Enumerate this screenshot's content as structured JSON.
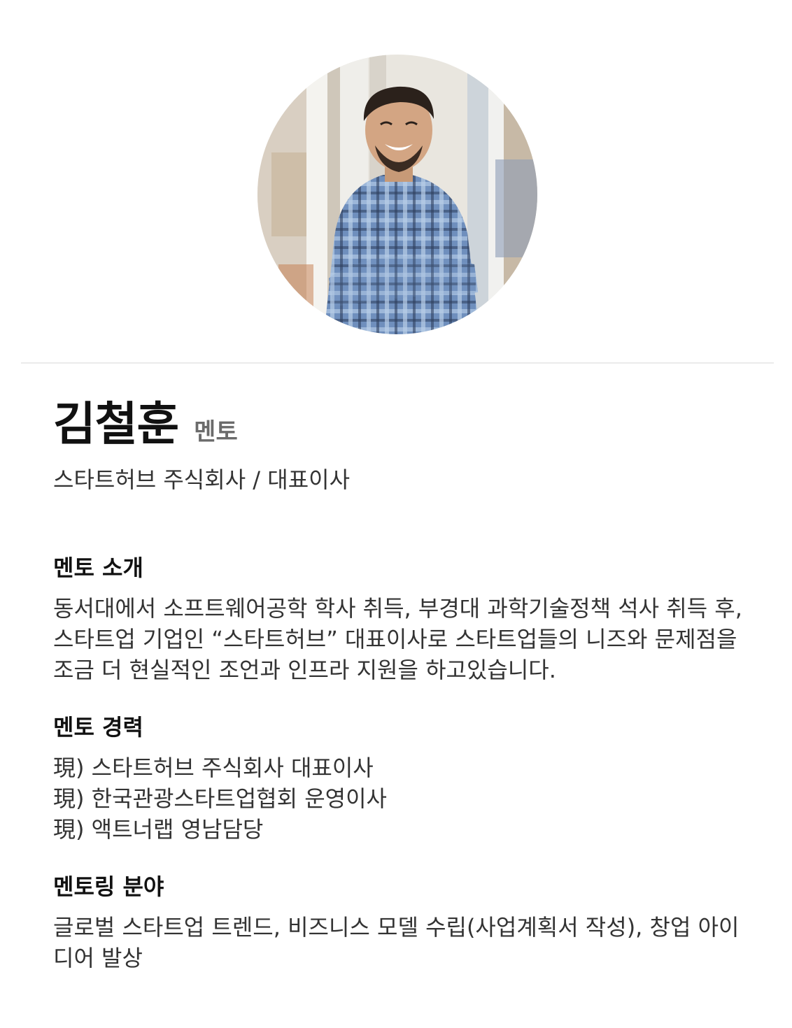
{
  "profile": {
    "name": "김철훈",
    "role": "멘토",
    "affiliation": "스타트허브 주식회사 / 대표이사",
    "photo_icon": "person-photo-icon"
  },
  "sections": {
    "intro": {
      "title": "멘토 소개",
      "body": "동서대에서 소프트웨어공학 학사 취득, 부경대 과학기술정책 석사 취득 후, 스타트업 기업인 “스타트허브” 대표이사로 스타트업들의 니즈와 문제점을 조금 더 현실적인 조언과 인프라 지원을 하고있습니다."
    },
    "career": {
      "title": "멘토 경력",
      "items": [
        "現) 스타트허브 주식회사 대표이사",
        "現) 한국관광스타트업협회 운영이사",
        "現) 액트너랩 영남담당"
      ]
    },
    "field": {
      "title": "멘토링 분야",
      "body": "글로벌 스타트업 트렌드, 비즈니스 모델 수립(사업계획서 작성), 창업 아이디어 발상"
    }
  },
  "colors": {
    "background": "#ffffff",
    "divider": "#ebebeb",
    "title_text": "#111111",
    "body_text": "#333333",
    "role_text": "#6b6b6b"
  }
}
